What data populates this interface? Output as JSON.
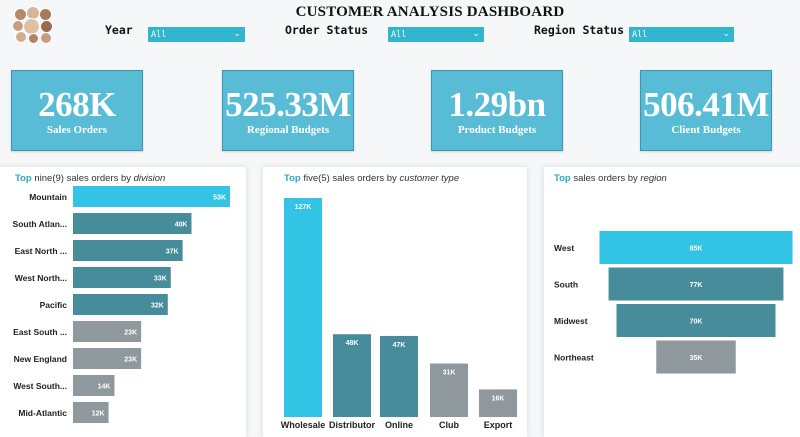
{
  "header": {
    "title": "CUSTOMER ANALYSIS DASHBOARD",
    "logo": "team-photo-collage"
  },
  "filters": [
    {
      "label": "Year",
      "value": "All"
    },
    {
      "label": "Order Status",
      "value": "All"
    },
    {
      "label": "Region Status",
      "value": "All"
    }
  ],
  "kpis": [
    {
      "value": "268K",
      "label": "Sales Orders"
    },
    {
      "value": "525.33M",
      "label": "Regional Budgets"
    },
    {
      "value": "1.29bn",
      "label": "Product Budgets"
    },
    {
      "value": "506.41M",
      "label": "Client Budgets"
    }
  ],
  "colors": {
    "accent": "#33c3e5",
    "teal": "#468c9a",
    "gray": "#8f989c",
    "kpi_bg": "#58bcd6",
    "title_accent": "#2aa9c8"
  },
  "panels": {
    "division": {
      "top": "Top",
      "prefix": " nine(9) sales orders by ",
      "dim": "division"
    },
    "customer": {
      "top": "Top",
      "prefix": " five(5) sales orders by ",
      "dim": "customer type"
    },
    "region": {
      "top": "Top",
      "prefix": " sales orders by ",
      "dim": "region"
    }
  },
  "chart_data": [
    {
      "type": "bar",
      "orientation": "horizontal",
      "categories": [
        "Mountain",
        "South Atlan...",
        "East North ...",
        "West North...",
        "Pacific",
        "East South ...",
        "New England",
        "West South...",
        "Mid-Atlantic"
      ],
      "values": [
        53,
        40,
        37,
        33,
        32,
        23,
        23,
        14,
        12
      ],
      "labels": [
        "53K",
        "40K",
        "37K",
        "33K",
        "32K",
        "23K",
        "23K",
        "14K",
        "12K"
      ],
      "bar_colors": [
        "#33c3e5",
        "#468c9a",
        "#468c9a",
        "#468c9a",
        "#468c9a",
        "#8f989c",
        "#8f989c",
        "#8f989c",
        "#8f989c"
      ],
      "grid": false
    },
    {
      "type": "bar",
      "orientation": "vertical",
      "categories": [
        "Wholesale",
        "Distributor",
        "Online",
        "Club",
        "Export"
      ],
      "values": [
        127,
        48,
        47,
        31,
        16
      ],
      "labels": [
        "127K",
        "48K",
        "47K",
        "31K",
        "16K"
      ],
      "bar_colors": [
        "#33c3e5",
        "#468c9a",
        "#468c9a",
        "#8f989c",
        "#8f989c"
      ],
      "grid": false
    },
    {
      "type": "funnel",
      "categories": [
        "West",
        "South",
        "Midwest",
        "Northeast"
      ],
      "values": [
        85,
        77,
        70,
        35
      ],
      "labels": [
        "85K",
        "77K",
        "70K",
        "35K"
      ],
      "bar_colors": [
        "#33c3e5",
        "#468c9a",
        "#468c9a",
        "#8f989c"
      ],
      "grid": false
    }
  ]
}
